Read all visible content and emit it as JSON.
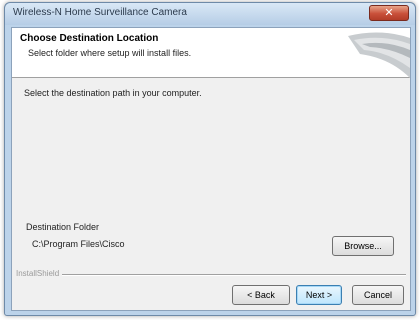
{
  "window": {
    "title": "Wireless-N Home Surveillance Camera",
    "close_glyph": "✕"
  },
  "header": {
    "title": "Choose Destination Location",
    "subtitle": "Select folder where setup will install files."
  },
  "body": {
    "prompt": "Select the destination path in your computer."
  },
  "destination": {
    "label": "Destination Folder",
    "path": "C:\\Program Files\\Cisco",
    "browse_label": "Browse..."
  },
  "footer": {
    "separator_label": "InstallShield",
    "back_label": "< Back",
    "next_label": "Next >",
    "cancel_label": "Cancel"
  },
  "icons": {
    "close": "close-icon",
    "header_graphic": "wizard-banner-graphic"
  },
  "colors": {
    "titlebar": "#bcd3ea",
    "client": "#f0f0f0",
    "close_button": "#c9503a",
    "default_button_border": "#3c7fb1"
  }
}
